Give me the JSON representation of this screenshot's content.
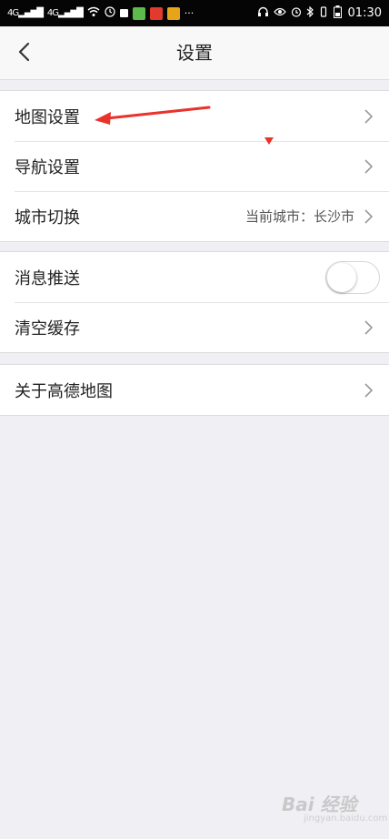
{
  "status_bar": {
    "signal_1": "4G",
    "signal_2": "4G",
    "more": "···",
    "time": "01:30"
  },
  "nav": {
    "title": "设置"
  },
  "groups": [
    {
      "rows": [
        {
          "label": "地图设置"
        },
        {
          "label": "导航设置"
        },
        {
          "label": "城市切换",
          "value": "当前城市：长沙市"
        }
      ]
    },
    {
      "rows": [
        {
          "label": "消息推送",
          "toggle_on": false
        },
        {
          "label": "清空缓存"
        }
      ]
    },
    {
      "rows": [
        {
          "label": "关于高德地图"
        }
      ]
    }
  ],
  "watermark": {
    "text": "Bai 经验",
    "sub": "jingyan.baidu.com"
  },
  "colors": {
    "annotation_red": "#e8322a",
    "page_bg": "#f0eff4"
  }
}
